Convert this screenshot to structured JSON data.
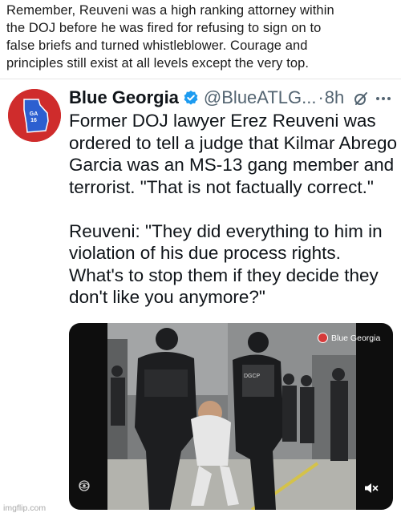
{
  "caption": {
    "lines": [
      "Remember, Reuveni was a high ranking attorney within",
      "the DOJ before he was fired for refusing to sign on to",
      "false briefs and turned whistleblower. Courage and",
      "principles still exist at all levels except the very top."
    ]
  },
  "tweet": {
    "author": "Blue Georgia",
    "handle": "@BlueATLG...",
    "separator": "·",
    "time": "8h",
    "avatar_text": "GA\n16",
    "paragraph1": [
      "Former DOJ lawyer Erez Reuveni was",
      "ordered to tell a judge that Kilmar Abrego",
      "Garcia was an MS-13 gang member and",
      "terrorist. \"That is not factually correct.\""
    ],
    "paragraph2": [
      "Reuveni: \"They did everything to him in",
      "violation of his due process rights.",
      "What's to stop them if they decide they",
      "don't like you anymore?\""
    ],
    "media": {
      "watermark": "Blue Georgia",
      "guard_badge": "DGCP"
    }
  },
  "footer": {
    "imgflip": "imgflip.com"
  },
  "colors": {
    "verified_blue": "#1d9bf0",
    "handle_gray": "#536471",
    "avatar_red": "#cf2c2c"
  },
  "icons": [
    "verified-badge-icon",
    "grok-icon",
    "more-options-icon",
    "cbs-eye-icon",
    "mute-icon"
  ]
}
